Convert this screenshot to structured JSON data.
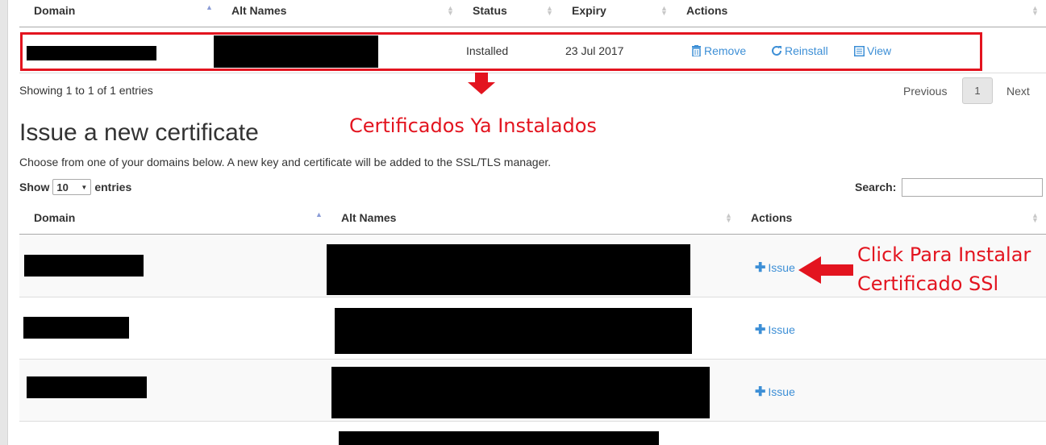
{
  "installed_table": {
    "columns": {
      "domain": "Domain",
      "alt_names": "Alt Names",
      "status": "Status",
      "expiry": "Expiry",
      "actions": "Actions"
    },
    "rows": [
      {
        "status": "Installed",
        "expiry": "23 Jul 2017",
        "actions": {
          "remove": "Remove",
          "reinstall": "Reinstall",
          "view": "View"
        }
      }
    ],
    "info": "Showing 1 to 1 of 1 entries",
    "pagination": {
      "previous": "Previous",
      "current_page": "1",
      "next": "Next"
    }
  },
  "annotations": {
    "installed_note": "Certificados Ya Instalados",
    "click_note_line1": "Click Para Instalar",
    "click_note_line2": "Certificado SSl"
  },
  "issue_section": {
    "title": "Issue a new certificate",
    "description": "Choose from one of your domains below. A new key and certificate will be added to the SSL/TLS manager.",
    "length_menu": {
      "show": "Show",
      "value": "10",
      "entries": "entries"
    },
    "search_label": "Search:",
    "search_value": "",
    "columns": {
      "domain": "Domain",
      "alt_names": "Alt Names",
      "actions": "Actions"
    },
    "rows": [
      {
        "action": "Issue"
      },
      {
        "action": "Issue"
      },
      {
        "action": "Issue"
      }
    ]
  },
  "colors": {
    "link": "#3d8fd6",
    "annotation_red": "#e3141f",
    "sort_active": "#8a9bd6"
  },
  "icons": [
    "trash-icon",
    "refresh-icon",
    "document-icon",
    "plus-icon",
    "sort-icon"
  ]
}
